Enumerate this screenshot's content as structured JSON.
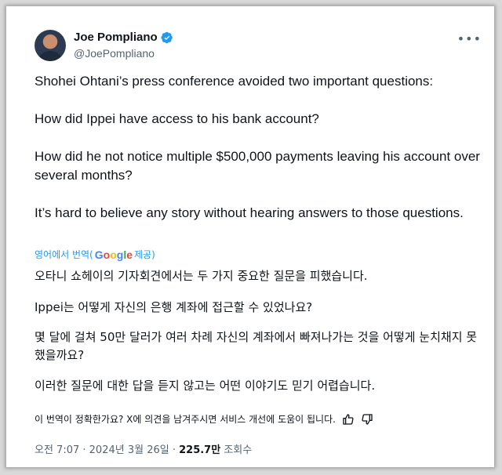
{
  "author": {
    "name": "Joe Pompliano",
    "handle": "@JoePompliano"
  },
  "more_label": "•••",
  "tweet": {
    "paragraphs": [
      "Shohei Ohtani’s press conference avoided two important questions:",
      "How did Ippei have access to his bank account?",
      "How did he not notice multiple $500,000 payments leaving his account over several months?",
      "It’s hard to believe any story without hearing answers to those questions."
    ]
  },
  "translation": {
    "link_prefix": "영어에서 번역(",
    "google": [
      "G",
      "o",
      "o",
      "g",
      "l",
      "e"
    ],
    "link_suffix": " 제공)",
    "paragraphs": [
      "오타니 쇼헤이의 기자회견에서는 두 가지 중요한 질문을 피했습니다.",
      "Ippei는 어떻게 자신의 은행 계좌에 접근할 수 있었나요?",
      "몇 달에 걸쳐 50만 달러가 여러 차례 자신의 계좌에서 빠져나가는 것을 어떻게 눈치채지 못했을까요?",
      "이러한 질문에 대한 답을 듣지 않고는 어떤 이야기도 믿기 어렵습니다."
    ],
    "feedback_prompt": "이 번역이 정확한가요? X에 의견을 남겨주시면 서비스 개선에 도움이 됩니다."
  },
  "meta": {
    "time": "오전 7:07",
    "date": "2024년 3월 26일",
    "views_count": "225.7만",
    "views_label": "조회수",
    "separator": " · "
  },
  "icons": {
    "verified": "verified-badge-icon",
    "thumbs_up": "thumbs-up-icon",
    "thumbs_down": "thumbs-down-icon"
  },
  "colors": {
    "accent": "#1d9bf0",
    "text": "#0f1419",
    "secondary": "#536471"
  }
}
